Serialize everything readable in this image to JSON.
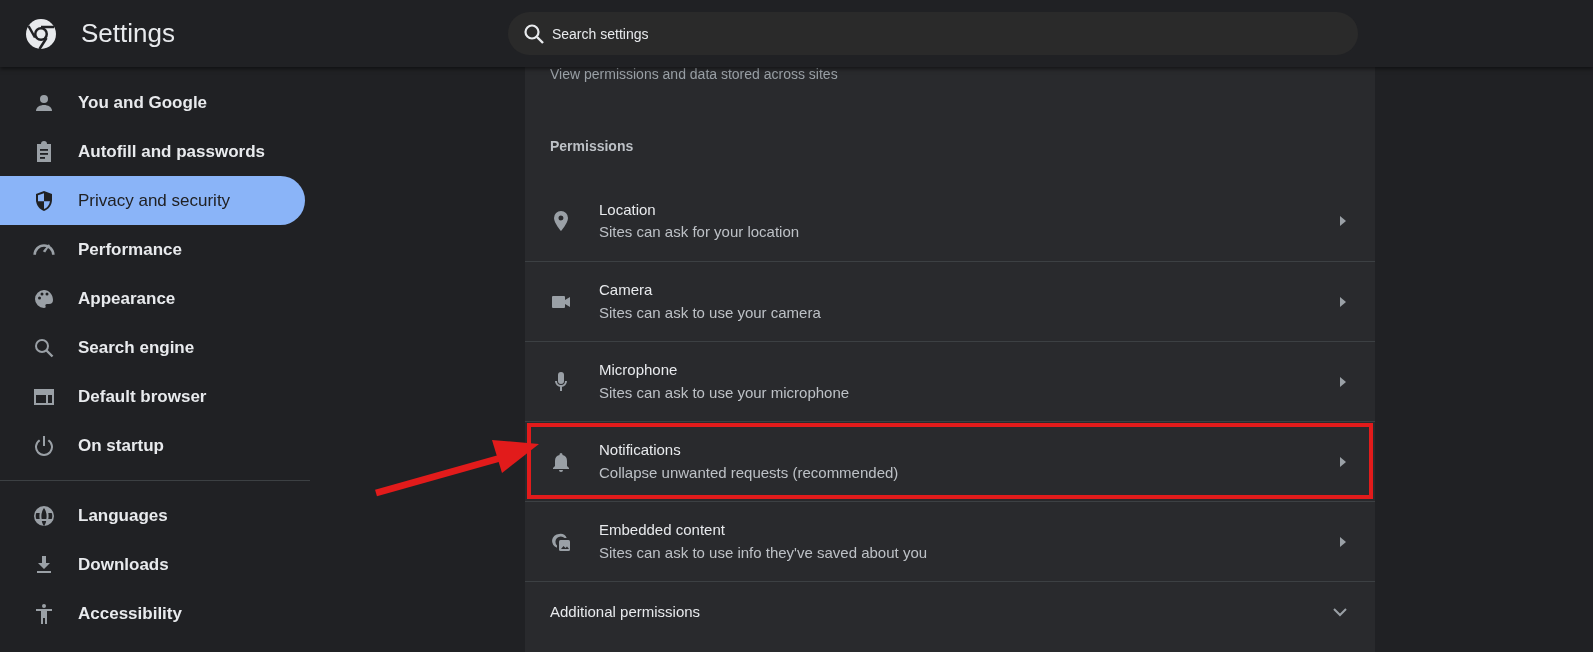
{
  "header": {
    "title": "Settings",
    "search": {
      "placeholder": "Search settings"
    }
  },
  "sidebar": {
    "groups": [
      [
        {
          "label": "You and Google",
          "selected": false
        },
        {
          "label": "Autofill and passwords",
          "selected": false
        },
        {
          "label": "Privacy and security",
          "selected": true
        },
        {
          "label": "Performance",
          "selected": false
        },
        {
          "label": "Appearance",
          "selected": false
        },
        {
          "label": "Search engine",
          "selected": false
        },
        {
          "label": "Default browser",
          "selected": false
        },
        {
          "label": "On startup",
          "selected": false
        }
      ],
      [
        {
          "label": "Languages",
          "selected": false
        },
        {
          "label": "Downloads",
          "selected": false
        },
        {
          "label": "Accessibility",
          "selected": false
        }
      ]
    ]
  },
  "content": {
    "cut_row": "View permissions and data stored across sites",
    "section_title": "Permissions",
    "permissions": [
      {
        "title": "Location",
        "subtitle": "Sites can ask for your location",
        "highlighted": false
      },
      {
        "title": "Camera",
        "subtitle": "Sites can ask to use your camera",
        "highlighted": false
      },
      {
        "title": "Microphone",
        "subtitle": "Sites can ask to use your microphone",
        "highlighted": false
      },
      {
        "title": "Notifications",
        "subtitle": "Collapse unwanted requests (recommended)",
        "highlighted": true
      },
      {
        "title": "Embedded content",
        "subtitle": "Sites can ask to use info they've saved about you",
        "highlighted": false
      }
    ],
    "additional": {
      "label": "Additional permissions",
      "expanded": false
    }
  }
}
